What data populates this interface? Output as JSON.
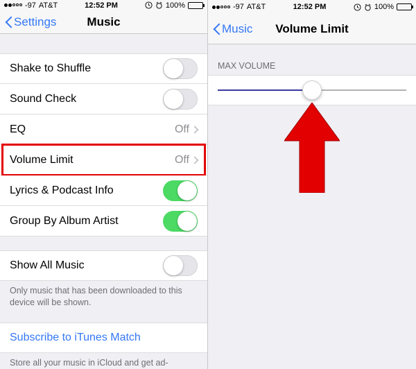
{
  "status": {
    "signal": "-97",
    "carrier": "AT&T",
    "time": "12:52 PM",
    "battery_percent": "100%",
    "battery_fill_pct": 100
  },
  "left": {
    "back_label": "Settings",
    "title": "Music",
    "rows": {
      "shake": {
        "label": "Shake to Shuffle",
        "on": false
      },
      "sound_check": {
        "label": "Sound Check",
        "on": false
      },
      "eq": {
        "label": "EQ",
        "value": "Off"
      },
      "volume_limit": {
        "label": "Volume Limit",
        "value": "Off"
      },
      "lyrics": {
        "label": "Lyrics & Podcast Info",
        "on": true
      },
      "group_album": {
        "label": "Group By Album Artist",
        "on": true
      },
      "show_all": {
        "label": "Show All Music",
        "on": false
      },
      "show_all_footer": "Only music that has been downloaded to this device will be shown.",
      "subscribe": {
        "label": "Subscribe to iTunes Match"
      },
      "subscribe_footer": "Store all your music in iCloud and get ad-"
    }
  },
  "right": {
    "back_label": "Music",
    "title": "Volume Limit",
    "section_header": "MAX VOLUME",
    "slider_pct": 50
  }
}
